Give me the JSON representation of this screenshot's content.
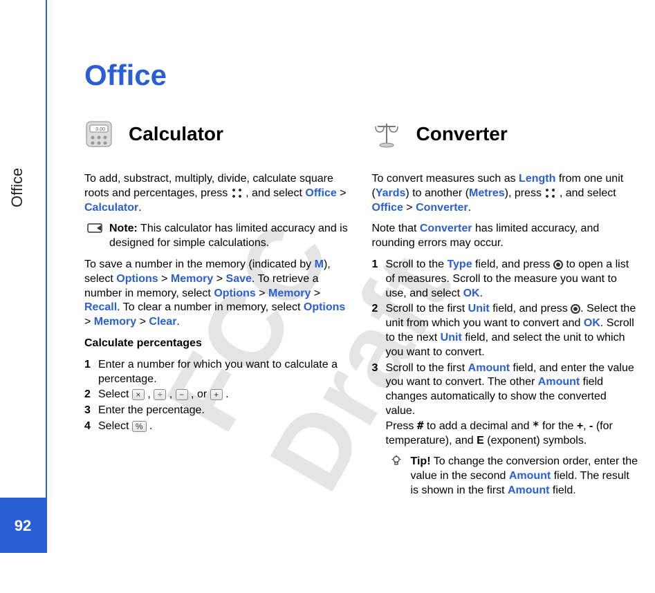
{
  "sidebar": {
    "label": "Office",
    "page_number": "92"
  },
  "title": "Office",
  "watermark": "FCC Draft",
  "calc": {
    "heading": "Calculator",
    "intro_a": "To add, substract, multiply, divide, calculate square roots and percentages, press ",
    "intro_b": " , and select ",
    "kw_office": "Office",
    "gt": " > ",
    "kw_calc": "Calculator",
    "intro_end": ".",
    "note_label": "Note:",
    "note_text": " This calculator has limited accuracy and is designed for simple calculations.",
    "save_a": "To save a number in the memory (indicated by ",
    "kw_M": "M",
    "save_b": "), select ",
    "kw_opt": "Options",
    "kw_mem": "Memory",
    "kw_save": "Save",
    "save_c": ". To retrieve a number in memory, select ",
    "kw_recall": "Recall",
    "save_d": ". To clear a number in memory, select ",
    "kw_clear": "Clear",
    "save_end": ".",
    "calc_pct_head": "Calculate percentages",
    "step1": "Enter a number for which you want to calculate a percentage.",
    "step2_pre": "Select ",
    "step2_sep": " , ",
    "step2_or": " , or ",
    "step2_end": " .",
    "key_mul": "×",
    "key_div": "÷",
    "key_sub": "−",
    "key_add": "+",
    "step3": "Enter the percentage.",
    "step4_pre": "Select ",
    "key_pct": "%",
    "step4_end": " ."
  },
  "conv": {
    "heading": "Converter",
    "intro_a": "To convert measures such as ",
    "kw_len": "Length",
    "intro_b": " from one unit (",
    "kw_yards": "Yards",
    "intro_c": ") to another (",
    "kw_metres": "Metres",
    "intro_d": "), press ",
    "intro_e": " , and select ",
    "kw_office": "Office",
    "gt": " > ",
    "kw_conv": "Converter",
    "intro_end": ".",
    "note2_a": "Note that ",
    "note2_b": " has limited accuracy, and rounding errors may occur.",
    "s1_a": "Scroll to the ",
    "kw_type": "Type",
    "s1_b": " field, and press ",
    "s1_c": " to open a list of measures. Scroll to the measure you want to use, and select ",
    "kw_ok": "OK",
    "s1_end": ".",
    "s2_a": "Scroll to the first ",
    "kw_unit": "Unit",
    "s2_b": " field, and press ",
    "s2_c": ". Select the unit from which you want to convert and ",
    "s2_d": ". Scroll to the next ",
    "s2_e": " field, and select the unit to which you want to convert.",
    "s3_a": "Scroll to the first ",
    "kw_amount": "Amount",
    "s3_b": " field, and enter the value you want to convert. The other ",
    "s3_c": " field changes automatically to show the converted value.",
    "s3_d": "Press ",
    "hash": "#",
    "s3_e": " to add a decimal and ",
    "star": "*",
    "s3_f": " for the ",
    "plus": "+",
    "comma": ", ",
    "minus": "-",
    "s3_g": " (for temperature), and ",
    "kw_E": "E",
    "s3_h": " (exponent) symbols.",
    "tip_label": "Tip!",
    "tip_a": " To change the conversion order, enter the value in the second ",
    "tip_b": " field. The result is shown in the first ",
    "tip_c": " field."
  }
}
